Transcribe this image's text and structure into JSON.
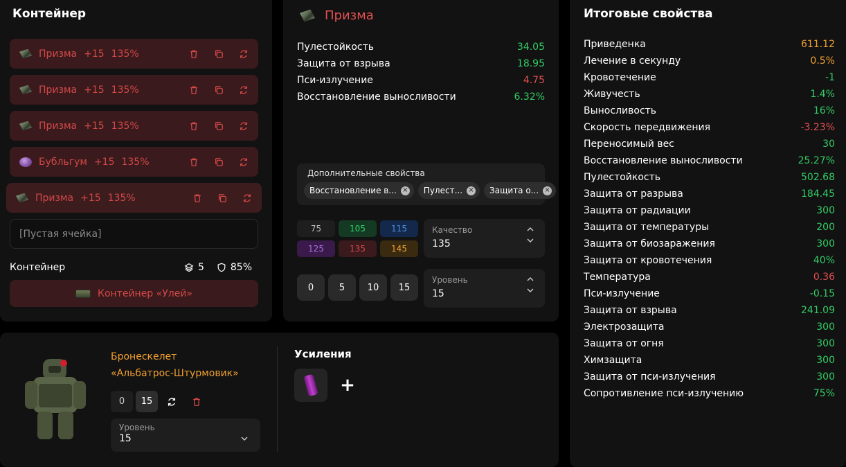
{
  "container": {
    "title": "Контейнер",
    "slots": [
      {
        "name": "Призма",
        "level": "+15",
        "quality": "135%",
        "art": "prism"
      },
      {
        "name": "Призма",
        "level": "+15",
        "quality": "135%",
        "art": "prism"
      },
      {
        "name": "Призма",
        "level": "+15",
        "quality": "135%",
        "art": "prism"
      },
      {
        "name": "Бубльгум",
        "level": "+15",
        "quality": "135%",
        "art": "bubble"
      },
      {
        "name": "Призма",
        "level": "+15",
        "quality": "135%",
        "art": "prism"
      }
    ],
    "slot_icons": [
      "trash-icon",
      "copy-icon",
      "refresh-icon"
    ],
    "empty_slot": "[Пустая ячейка]",
    "footer_label": "Контейнер",
    "capacity": "5",
    "protection": "85%",
    "button_label": "Контейнер «Улей»"
  },
  "artifact": {
    "title": "Призма",
    "properties": [
      {
        "label": "Пулестойкость",
        "value": "34.05",
        "color": "green"
      },
      {
        "label": "Защита от взрыва",
        "value": "18.95",
        "color": "green"
      },
      {
        "label": "Пси-излучение",
        "value": "4.75",
        "color": "red"
      },
      {
        "label": "Восстановление выносливости",
        "value": "6.32%",
        "color": "green"
      }
    ],
    "extra_label": "Дополнительные свойства",
    "extra_chips": [
      "Восстановление в...",
      "Пулест...",
      "Защита о..."
    ],
    "quality_options": [
      "75",
      "105",
      "115",
      "125",
      "135",
      "145"
    ],
    "quality_label": "Качество",
    "quality_value": "135",
    "level_options": [
      "0",
      "5",
      "10",
      "15"
    ],
    "level_label": "Уровень",
    "level_value": "15"
  },
  "armor": {
    "name_line1": "Бронескелет",
    "name_line2": "«Альбатрос-Штурмовик»",
    "level_options": [
      "0",
      "15"
    ],
    "level_label": "Уровень",
    "level_value": "15",
    "boosts_title": "Усиления",
    "add_label": "+"
  },
  "totals": {
    "title": "Итоговые свойства",
    "properties": [
      {
        "label": "Приведенка",
        "value": "611.12",
        "color": "orange"
      },
      {
        "label": "Лечение в секунду",
        "value": "0.5%",
        "color": "orange"
      },
      {
        "label": "Кровотечение",
        "value": "-1",
        "color": "green"
      },
      {
        "label": "Живучесть",
        "value": "1.4%",
        "color": "green"
      },
      {
        "label": "Выносливость",
        "value": "16%",
        "color": "green"
      },
      {
        "label": "Скорость передвижения",
        "value": "-3.23%",
        "color": "red"
      },
      {
        "label": "Переносимый вес",
        "value": "30",
        "color": "green"
      },
      {
        "label": "Восстановление выносливости",
        "value": "25.27%",
        "color": "green"
      },
      {
        "label": "Пулестойкость",
        "value": "502.68",
        "color": "green"
      },
      {
        "label": "Защита от разрыва",
        "value": "184.45",
        "color": "green"
      },
      {
        "label": "Защита от радиации",
        "value": "300",
        "color": "green"
      },
      {
        "label": "Защита от температуры",
        "value": "200",
        "color": "green"
      },
      {
        "label": "Защита от биозаражения",
        "value": "300",
        "color": "green"
      },
      {
        "label": "Защита от кровотечения",
        "value": "40%",
        "color": "green"
      },
      {
        "label": "Температура",
        "value": "0.36",
        "color": "red"
      },
      {
        "label": "Пси-излучение",
        "value": "-0.15",
        "color": "green"
      },
      {
        "label": "Защита от взрыва",
        "value": "241.09",
        "color": "green"
      },
      {
        "label": "Электрозащита",
        "value": "300",
        "color": "green"
      },
      {
        "label": "Защита от огня",
        "value": "300",
        "color": "green"
      },
      {
        "label": "Химзащита",
        "value": "300",
        "color": "green"
      },
      {
        "label": "Защита от пси-излучения",
        "value": "300",
        "color": "green"
      },
      {
        "label": "Сопротивление пси-излучению",
        "value": "75%",
        "color": "green"
      }
    ]
  },
  "colors": {
    "accent_red": "#d24848",
    "accent_green": "#33cc66",
    "accent_orange": "#f0a030",
    "slot_bg": "#3a1a1c",
    "panel_bg": "#121212"
  }
}
